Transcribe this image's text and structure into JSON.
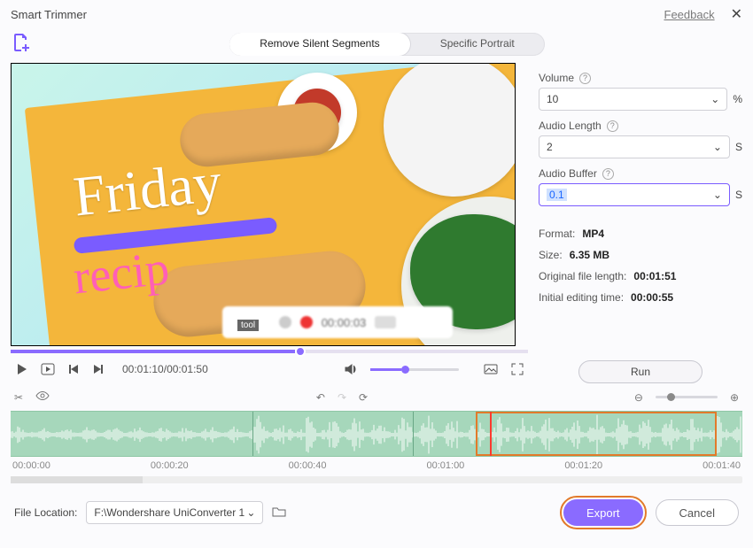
{
  "window": {
    "title": "Smart Trimmer",
    "feedback": "Feedback"
  },
  "tabs": {
    "remove": "Remove Silent Segments",
    "portrait": "Specific Portrait"
  },
  "preview": {
    "word1": "Friday",
    "word2": "recip",
    "strip_time": "00:00:03",
    "tool_chip": "tool"
  },
  "playback": {
    "time_current": "00:01:10",
    "time_total": "00:01:50"
  },
  "side": {
    "volume_label": "Volume",
    "volume_value": "10",
    "volume_unit": "%",
    "length_label": "Audio Length",
    "length_value": "2",
    "length_unit": "S",
    "buffer_label": "Audio Buffer",
    "buffer_value": "0.1",
    "buffer_unit": "S",
    "format_label": "Format:",
    "format_value": "MP4",
    "size_label": "Size:",
    "size_value": "6.35 MB",
    "orig_label": "Original file length:",
    "orig_value": "00:01:51",
    "edit_label": "Initial editing time:",
    "edit_value": "00:00:55",
    "run": "Run"
  },
  "ruler": [
    "00:00:00",
    "00:00:20",
    "00:00:40",
    "00:01:00",
    "00:01:20",
    "00:01:40"
  ],
  "footer": {
    "location_label": "File Location:",
    "path": "F:\\Wondershare UniConverter 1",
    "export": "Export",
    "cancel": "Cancel"
  }
}
